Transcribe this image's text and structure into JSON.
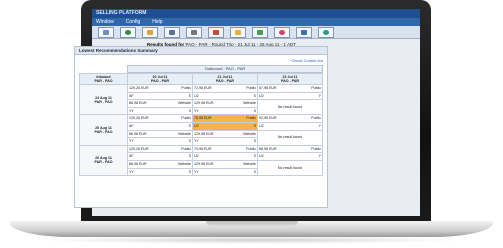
{
  "app": {
    "title": "SELLING PLATFORM",
    "menu": [
      "Window",
      "Config",
      "Help"
    ]
  },
  "toolbar": {
    "icons": [
      "home-icon",
      "globe-icon",
      "folder-icon",
      "people-icon",
      "printer-icon",
      "ticket-icon",
      "chart-icon",
      "mail-icon",
      "heart-icon",
      "document-icon",
      "info-icon"
    ]
  },
  "results": {
    "label": "Results found for",
    "query": "PAO - PAR - Round Trip - 21 Jul 11 - 25 Aug 11 - 1 ADT"
  },
  "panel": {
    "title": "Lowest Recommendations Summary",
    "counts_link": "Check Counts too",
    "outbound_header": "Outbound : PAO - PAR",
    "corner_top": "Inbound",
    "corner_bottom": "PAR - PAO",
    "columns": [
      {
        "date": "20 Jul 11",
        "route": "PAO - PAR"
      },
      {
        "date": "21 Jul 11",
        "route": "PAO - PAR"
      },
      {
        "date": "22 Jul 11",
        "route": "PAO - PAR"
      }
    ],
    "rows": [
      {
        "date": "24 Aug 11",
        "route": "PAR - PAO",
        "cells": [
          [
            {
              "l": "129,26 EUR",
              "r": "Public"
            },
            {
              "l": "AF",
              "r": "S"
            },
            {
              "l": "86,98 EUR",
              "r": "Website"
            },
            {
              "l": "YY",
              "r": "S"
            }
          ],
          [
            {
              "l": "72,98 EUR",
              "r": "Public"
            },
            {
              "l": "U2",
              "r": "S"
            },
            {
              "l": "129,98 EUR",
              "r": "Website"
            },
            {
              "l": "YY",
              "r": "S"
            }
          ],
          [
            {
              "l": "67,98 EUR",
              "r": "Public"
            },
            {
              "l": "U2",
              "r": "Y"
            },
            {
              "l": "No result found",
              "r": ""
            },
            {
              "l": "",
              "r": ""
            }
          ]
        ]
      },
      {
        "date": "25 Aug 11",
        "route": "PAR - PAO",
        "cells": [
          [
            {
              "l": "129,26 EUR",
              "r": "Public"
            },
            {
              "l": "AF",
              "r": "S"
            },
            {
              "l": "86,98 EUR",
              "r": "Website"
            },
            {
              "l": "YY",
              "r": "S"
            }
          ],
          [
            {
              "l": "78,98 EUR",
              "r": "Public"
            },
            {
              "l": "U2",
              "r": "S"
            },
            {
              "l": "129,98 EUR",
              "r": "Website"
            },
            {
              "l": "YY",
              "r": "S"
            }
          ],
          [
            {
              "l": "92,98 EUR",
              "r": "Public"
            },
            {
              "l": "U2",
              "r": "Y"
            },
            {
              "l": "No result found",
              "r": ""
            },
            {
              "l": "",
              "r": ""
            }
          ]
        ]
      },
      {
        "date": "26 Aug 11",
        "route": "PAR - PAO",
        "cells": [
          [
            {
              "l": "129,26 EUR",
              "r": "Public"
            },
            {
              "l": "AF",
              "r": "S"
            },
            {
              "l": "86,98 EUR",
              "r": "Website"
            },
            {
              "l": "YY",
              "r": "S"
            }
          ],
          [
            {
              "l": "70,98 EUR",
              "r": "Public"
            },
            {
              "l": "U2",
              "r": "S"
            },
            {
              "l": "129,98 EUR",
              "r": "Website"
            },
            {
              "l": "YY",
              "r": "S"
            }
          ],
          [
            {
              "l": "88,98 EUR",
              "r": "Public"
            },
            {
              "l": "U2",
              "r": "Y"
            },
            {
              "l": "No result found",
              "r": ""
            },
            {
              "l": "",
              "r": ""
            }
          ]
        ]
      }
    ]
  },
  "colors": {
    "titlebar": "#1e4f8f",
    "menubar": "#2f67ad",
    "selected_cell": "#f7b24c"
  }
}
